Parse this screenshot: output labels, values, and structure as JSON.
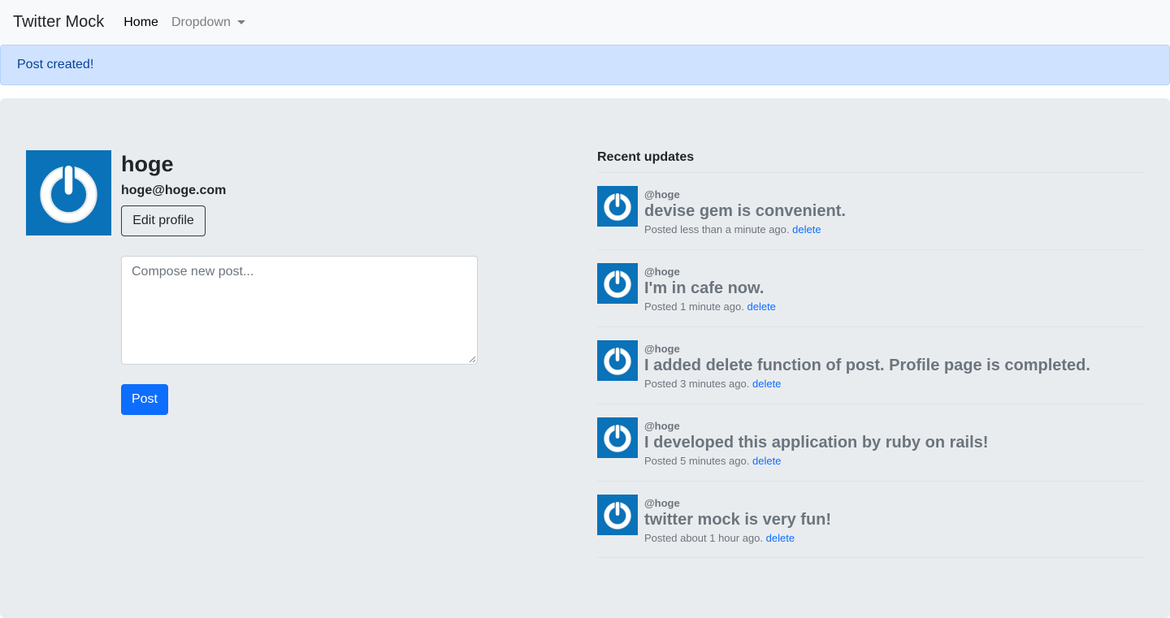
{
  "navbar": {
    "brand": "Twitter Mock",
    "home": "Home",
    "dropdown": "Dropdown"
  },
  "alert": {
    "message": "Post created!"
  },
  "profile": {
    "name": "hoge",
    "email": "hoge@hoge.com",
    "edit_label": "Edit profile",
    "avatar_icon": "power-logo-avatar",
    "avatar_color": "#0a72b8"
  },
  "composer": {
    "placeholder": "Compose new post...",
    "value": "",
    "submit_label": "Post"
  },
  "feed": {
    "title": "Recent updates",
    "delete_label": "delete",
    "posts": [
      {
        "user": "@hoge",
        "content": "devise gem is convenient.",
        "time": "Posted less than a minute ago."
      },
      {
        "user": "@hoge",
        "content": "I'm in cafe now.",
        "time": "Posted 1 minute ago."
      },
      {
        "user": "@hoge",
        "content": "I added delete function of post. Profile page is completed.",
        "time": "Posted 3 minutes ago."
      },
      {
        "user": "@hoge",
        "content": "I developed this application by ruby on rails!",
        "time": "Posted 5 minutes ago."
      },
      {
        "user": "@hoge",
        "content": "twitter mock is very fun!",
        "time": "Posted about 1 hour ago."
      }
    ]
  },
  "colors": {
    "primary": "#0d6efd",
    "alert_bg": "#cfe2ff",
    "jumbotron_bg": "#e9ecef",
    "navbar_bg": "#f8f9fa"
  }
}
